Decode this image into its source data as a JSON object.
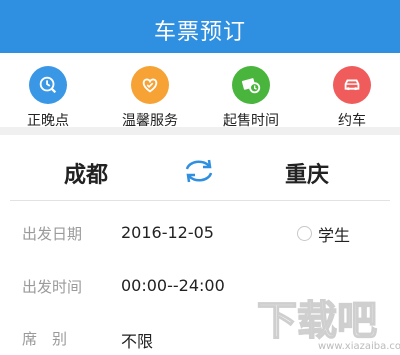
{
  "header": {
    "title": "车票预订",
    "bg_color": "#2f8fe0"
  },
  "quick_menu": [
    {
      "label": "正晚点",
      "icon": "clock-search-icon",
      "color": "#3a97e6"
    },
    {
      "label": "温馨服务",
      "icon": "heart-hand-icon",
      "color": "#f6a234"
    },
    {
      "label": "起售时间",
      "icon": "ticket-clock-icon",
      "color": "#4ab53d"
    },
    {
      "label": "约车",
      "icon": "car-icon",
      "color": "#f05b5b"
    }
  ],
  "route": {
    "from": "成都",
    "to": "重庆",
    "swap_icon": "swap-icon"
  },
  "form": {
    "date_label": "出发日期",
    "date_value": "2016-12-05",
    "student_label": "学生",
    "time_label": "出发时间",
    "time_value": "00:00--24:00",
    "seat_label": "席　别",
    "seat_value": "不限"
  },
  "watermark": {
    "text": "下载吧",
    "sub": "www.xiazaiba.com"
  }
}
